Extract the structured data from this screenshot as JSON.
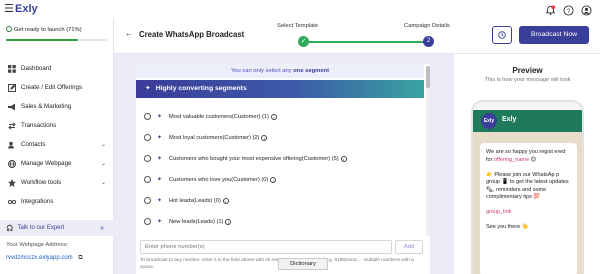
{
  "app": {
    "logo": "Exly",
    "menu_icon": "hamburger-icon"
  },
  "topbar_icons": [
    "notification-bell-icon",
    "help-icon",
    "account-icon"
  ],
  "sidebar": {
    "launch_text": "Get ready to launch (71%)",
    "launch_progress": 0.71,
    "items": [
      {
        "label": "Dashboard",
        "icon": "dashboard-icon",
        "chevron": false
      },
      {
        "label": "Create / Edit Offerings",
        "icon": "edit-offerings-icon",
        "chevron": false
      },
      {
        "label": "Sales & Marketing",
        "icon": "sales-icon",
        "chevron": false
      },
      {
        "label": "Transactions",
        "icon": "transactions-icon",
        "chevron": false
      },
      {
        "label": "Contacts",
        "icon": "contacts-icon",
        "chevron": true
      },
      {
        "label": "Manage Webpage",
        "icon": "webpage-icon",
        "chevron": true
      },
      {
        "label": "Workflow tools",
        "icon": "workflow-icon",
        "chevron": true
      },
      {
        "label": "Integrations",
        "icon": "integrations-icon",
        "chevron": false
      }
    ],
    "expert_label": "Talk to our Expert",
    "webpage_label": "Your Webpage Address:",
    "webpage_url": "rvvdzmcczx.exlyapp.com"
  },
  "header": {
    "back_symbol": "←",
    "title": "Create WhatsApp Broadcast",
    "steps": [
      {
        "label": "Select Template",
        "marker": "✓"
      },
      {
        "label": "Campaign Details",
        "marker": "2"
      }
    ],
    "broadcast_button": "Broadcast Now"
  },
  "segments": {
    "notice_prefix": "You can only select any ",
    "notice_emphasis": "one segment",
    "header": "Highly converting segments",
    "items": [
      "Most valuable customers(Customer) (1)",
      "Most loyal customers(Customer) (2)",
      "Customers who bought your most expensive offering(Customer) (5)",
      "Customers who love you(Customer) (0)",
      "Hot leads(Leads) (0)",
      "New leads(Leads) (1)"
    ],
    "phone_placeholder": "Enter phone number(s)",
    "add_label": "Add",
    "hint": "To broadcast to any number, enter it in the field above with its respective country code (e.g. 91982xxxx… multiple numbers with a space."
  },
  "tooltip": "Dictionary",
  "preview": {
    "title": "Preview",
    "subtitle": "This is how your message will look",
    "sender": "Exly",
    "avatar_text": "Exly",
    "message": {
      "line1": "We are so happy you regist ered for ",
      "placeholder1": "offering_name",
      "line2": " 😊",
      "line3": "👉 Please join our WhatsAp p group 📱 to get the latest updates 🗞, reminders and some complimentary tips 💯",
      "placeholder2": "group_link",
      "line4": "See you there 👋"
    }
  },
  "colors": {
    "brand": "#3a3f9a",
    "success": "#2eaa5a",
    "whatsapp": "#1f7a5c"
  }
}
